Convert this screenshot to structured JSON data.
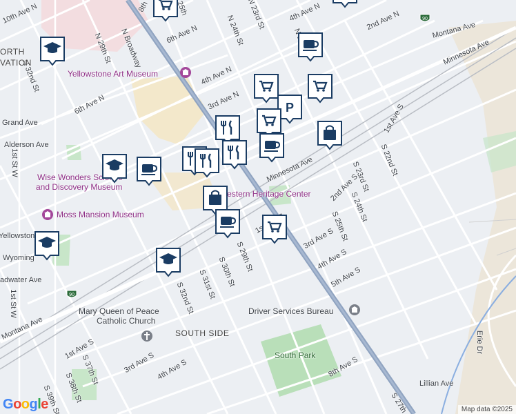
{
  "map": {
    "attribution": "Map data ©2025",
    "logo": "Google"
  },
  "places": {
    "north_elevation_1": "ORTH",
    "north_elevation_2": "VATION",
    "south_side": "SOUTH SIDE",
    "south_park": "South Park",
    "driver_services": "Driver Services Bureau",
    "church_1": "Mary Queen of Peace",
    "church_2": "Catholic Church",
    "art_museum": "Yellowstone Art Museum",
    "wise_wonders_1": "Wise Wonders Science",
    "wise_wonders_2": "and Discovery Museum",
    "moss_mansion": "Moss Mansion Museum",
    "western_heritage": "Western Heritage Center"
  },
  "streets": {
    "8th": "8th",
    "25th": "25th",
    "n23rd": "N 23rd St",
    "n24th": "N 24th St",
    "ave4n": "4th Ave N",
    "ave2n": "2nd Ave N",
    "ave6n_top": "6th Ave N",
    "ave10n": "10th Ave N",
    "n29th": "N 29th St",
    "broadway": "N Broadway",
    "n32nd": "N 32nd St",
    "ave6n": "6th Ave N",
    "ave4n_mid": "4th Ave N",
    "ave3n": "3rd Ave N",
    "grand": "Grand Ave",
    "alderson": "Alderson Ave",
    "st1w": "1st St W",
    "yellowstone": "Yellowstone",
    "wyoming": "Wyoming",
    "broadwater": "adwater Ave",
    "st1w2": "1st St W",
    "montana_left": "Montana Ave",
    "montana_top": "Montana Ave",
    "minnesota_top": "Minnesota Ave",
    "minnesota_mid": "Minnesota Ave",
    "n2": "N 2",
    "s1st": "1st Ave S",
    "s22nd": "S 22nd St",
    "s23rd": "S 23rd St",
    "s24th": "S 24th St",
    "ave2s": "2nd Ave S",
    "s25th": "S 25th St",
    "ave3s": "3rd Ave S",
    "ave4s": "4th Ave S",
    "ave5s": "5th Ave S",
    "s29th": "S 29th St",
    "s30th": "S 30th St",
    "s31st": "S 31st St",
    "s32nd": "S 32nd St",
    "ave1s": "1st Ave S",
    "s37th": "S 37th St",
    "ave3s_b": "3rd Ave S",
    "ave4s_b": "4th Ave S",
    "s38th": "S 38th St",
    "s39th": "S 39th St",
    "ave8s": "8th Ave S",
    "s27th": "S 27th",
    "lillian": "Lillian Ave",
    "erie": "Erie Dr",
    "ave1s_mid": "1st Ave S"
  },
  "highways": {
    "i90_top": "90",
    "i90_left": "90"
  },
  "markers": [
    {
      "type": "shopping-cart",
      "label": "shopping"
    },
    {
      "type": "shopping-cart",
      "label": "shopping"
    },
    {
      "type": "graduation-cap",
      "label": "school"
    },
    {
      "type": "coffee-cup",
      "label": "cafe"
    },
    {
      "type": "shopping-cart",
      "label": "shopping"
    },
    {
      "type": "shopping-cart",
      "label": "shopping"
    },
    {
      "type": "parking",
      "label": "parking"
    },
    {
      "type": "shopping-cart",
      "label": "shopping"
    },
    {
      "type": "shopping-bag",
      "label": "store"
    },
    {
      "type": "restaurant",
      "label": "restaurant"
    },
    {
      "type": "coffee-cup",
      "label": "cafe"
    },
    {
      "type": "restaurant",
      "label": "restaurant"
    },
    {
      "type": "restaurant",
      "label": "restaurant"
    },
    {
      "type": "graduation-cap",
      "label": "school"
    },
    {
      "type": "coffee-cup",
      "label": "cafe"
    },
    {
      "type": "restaurant",
      "label": "restaurant"
    },
    {
      "type": "shopping-bag",
      "label": "store"
    },
    {
      "type": "coffee-cup",
      "label": "cafe"
    },
    {
      "type": "shopping-cart",
      "label": "shopping"
    },
    {
      "type": "graduation-cap",
      "label": "school"
    },
    {
      "type": "graduation-cap",
      "label": "school"
    }
  ],
  "colors": {
    "background": "#eceff3",
    "highway": "#8fa3c0",
    "park": "#c8e6c9",
    "downtown": "#f5e6c0",
    "marker": "#1a3c63",
    "poi_label": "#8e2f86"
  }
}
